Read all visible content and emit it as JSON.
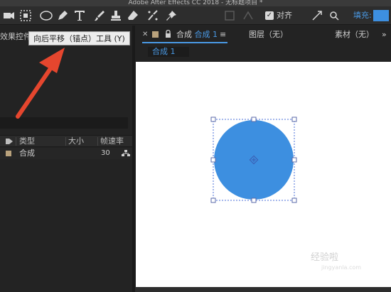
{
  "app": {
    "title": "Adobe After Effects CC 2018 - 无标题项目 *"
  },
  "toolbar": {
    "tools": [
      "home-icon",
      "pan-behind-icon",
      "ellipse-icon",
      "pen-icon",
      "type-icon",
      "brush-icon",
      "stamp-icon",
      "eraser-icon",
      "roto-brush-icon",
      "puppet-pin-icon"
    ],
    "align_label": "对齐",
    "align_checked": true,
    "fill_label": "填充:",
    "fill_color": "#3d8fe0"
  },
  "tooltip": {
    "text": "向后平移（锚点）工具 (Y)"
  },
  "left_panel": {
    "tab_label": "效果控件",
    "columns": {
      "type": "类型",
      "size": "大小",
      "fps": "帧速率"
    },
    "rows": [
      {
        "name": "合成",
        "fps": "30"
      }
    ]
  },
  "composition": {
    "tab_prefix": "合成",
    "tab_name": "合成 1",
    "layer_tab": "图层（无）",
    "footage_tab": "素材（无）",
    "subtab": "合成 1",
    "circle_color": "#3d8fe0"
  },
  "watermark": {
    "text": "经验啦",
    "url": "jingyanla.com"
  },
  "colors": {
    "accent": "#4a9ae6",
    "arrow": "#e5462e",
    "label_swatch": "#b9a27c"
  }
}
